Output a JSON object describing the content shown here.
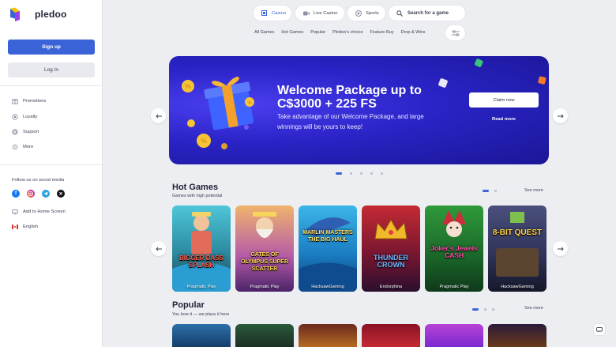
{
  "brand": {
    "name": "pledoo"
  },
  "sidebar": {
    "signup_label": "Sign up",
    "login_label": "Log In",
    "nav": [
      {
        "label": "Promotions",
        "icon": "promotions-icon"
      },
      {
        "label": "Loyalty",
        "icon": "loyalty-icon"
      },
      {
        "label": "Support",
        "icon": "support-icon"
      },
      {
        "label": "More",
        "icon": "more-icon"
      }
    ],
    "follow_title": "Follow us on social media",
    "socials": [
      "facebook-icon",
      "instagram-icon",
      "telegram-icon",
      "x-icon"
    ],
    "add_home": "Add to Home Screen",
    "language": "English"
  },
  "topnav": {
    "tabs": [
      {
        "label": "Casino",
        "icon": "casino-icon",
        "active": true
      },
      {
        "label": "Live Casino",
        "icon": "live-casino-icon",
        "active": false
      },
      {
        "label": "Sports",
        "icon": "sports-icon",
        "active": false
      }
    ],
    "search_placeholder": "Search for a game",
    "categories": [
      "All Games",
      "Hot Games",
      "Popular",
      "Pledoo's choice",
      "Feature Buy",
      "Drop & Wins"
    ]
  },
  "banner": {
    "title": "Welcome Package up to C$3000 + 225 FS",
    "text": "Take advantage of our Welcome Package, and large winnings will be yours to keep!",
    "claim_label": "Claim now",
    "read_more": "Read more",
    "slides": 5,
    "active_slide": 1
  },
  "hot_games": {
    "title": "Hot Games",
    "subtitle": "Games with high potential",
    "see_more": "See more",
    "games": [
      {
        "title": "BIGGER BASS SPLASH",
        "provider": "Pragmatic Play"
      },
      {
        "title": "GATES OF OLYMPUS SUPER SCATTER",
        "provider": "Pragmatic Play"
      },
      {
        "title": "MARLIN MASTERS THE BIG HAUL",
        "provider": "HacksawGaming"
      },
      {
        "title": "THUNDER CROWN",
        "provider": "Endorphina"
      },
      {
        "title": "Joker's Jewels CASH",
        "provider": "Pragmatic Play"
      },
      {
        "title": "8-BIT QUEST",
        "provider": "HacksawGaming"
      }
    ]
  },
  "popular": {
    "title": "Popular",
    "subtitle": "You love it — we place it here",
    "see_more": "See more"
  },
  "colors": {
    "accent": "#3a63d8",
    "banner": "#2a23c6",
    "background": "#eceef2"
  }
}
